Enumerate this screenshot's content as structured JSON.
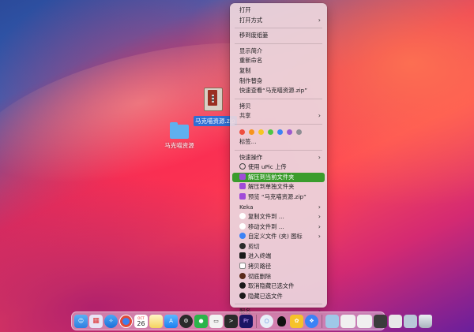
{
  "desktop": {
    "zip_file": {
      "label": "马克喵资源.zip"
    },
    "folder": {
      "label": "马克喵资源"
    }
  },
  "context_menu": {
    "open": "打开",
    "open_with": "打开方式",
    "move_to_trash": "移到废纸篓",
    "get_info": "显示简介",
    "rename": "重新命名",
    "duplicate": "复制",
    "make_alias": "制作替身",
    "quick_look": "快速查看“马克喵资源.zip”",
    "copy": "拷贝",
    "share": "共享",
    "tag_colors": [
      "#ee4d3f",
      "#f7941d",
      "#f5c622",
      "#4cc644",
      "#3c82f5",
      "#9b59d0",
      "#8e8e93"
    ],
    "tags": "标签...",
    "quick_actions": "快速操作",
    "upic_upload": "使用 uPic 上传",
    "extract_here": "解压到当前文件夹",
    "extract_separate": "解压到单独文件夹",
    "preview_zip": "预览 “马克喵资源.zip”",
    "keka": "Keka",
    "copy_file_to": "复制文件到 ...",
    "move_file_to": "移动文件到 ...",
    "custom_icon": "自定义文件 (夹) 图标",
    "cut": "剪切",
    "open_terminal": "进入终端",
    "copy_path": "拷贝路径",
    "delete_permanently": "彻底删除",
    "unhide_selected": "取消隐藏已选文件",
    "hide_selected": "隐藏已选文件",
    "services": "服务",
    "highlight_color": "#3a9c2c"
  },
  "dock": {
    "calendar_month": "OCT",
    "calendar_day": "26",
    "premiere_label": "Pr",
    "qq_label": "QQ"
  }
}
